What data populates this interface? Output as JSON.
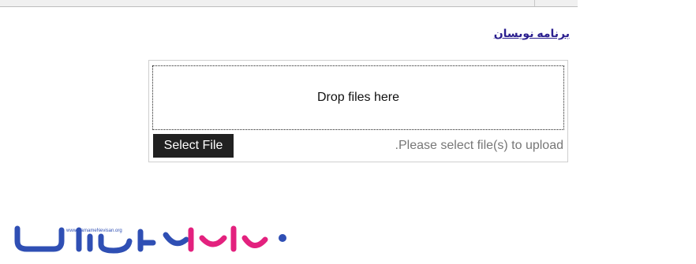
{
  "site_link": "برنامه نویسان",
  "uploader": {
    "drop_text": "Drop files here",
    "select_label": "Select File",
    "hint": ".Please select file(s) to upload"
  },
  "logo": {
    "url_text": "www.BarnameNevisan.org",
    "colors": {
      "primary": "#2f4fb4",
      "accent": "#e3217e"
    },
    "icon": "barnamenevisan-logo"
  }
}
